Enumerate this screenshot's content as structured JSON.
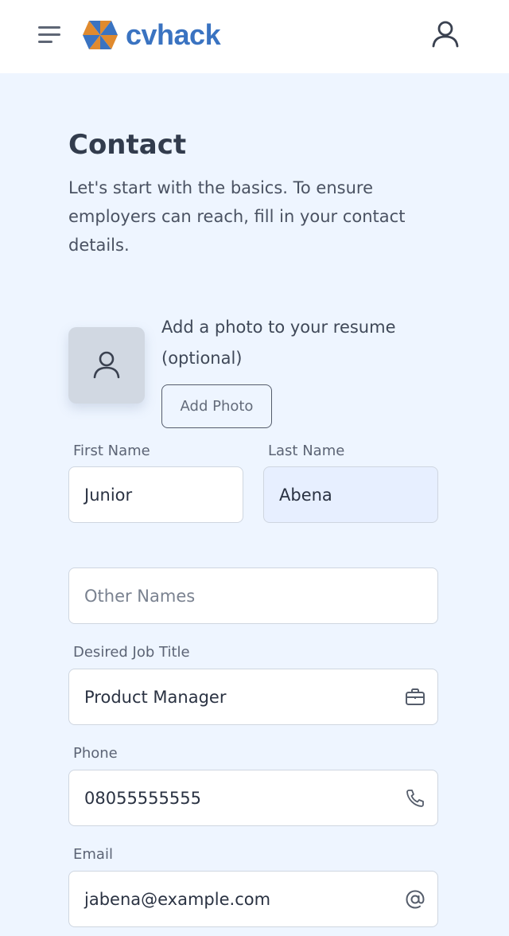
{
  "header": {
    "brand": "cvhack",
    "menu_icon": "hamburger-menu-icon",
    "profile_icon": "user-icon",
    "brand_colors": {
      "blue": "#3a73c1",
      "orange": "#e08a2e"
    }
  },
  "contact": {
    "title": "Contact",
    "subtitle": "Let's start with the basics. To ensure employers can reach, fill in your contact details."
  },
  "photo": {
    "prompt": "Add a photo to your resume (optional)",
    "button_label": "Add Photo",
    "placeholder_icon": "user-icon"
  },
  "form": {
    "first_name": {
      "label": "First Name",
      "value": "Junior"
    },
    "last_name": {
      "label": "Last Name",
      "value": "Abena"
    },
    "other_names": {
      "placeholder": "Other Names",
      "value": ""
    },
    "job_title": {
      "label": "Desired Job Title",
      "value": "Product Manager",
      "icon": "briefcase-icon"
    },
    "phone": {
      "label": "Phone",
      "value": "08055555555",
      "icon": "phone-icon"
    },
    "email": {
      "label": "Email",
      "value": "jabena@example.com",
      "icon": "at-sign-icon"
    }
  }
}
